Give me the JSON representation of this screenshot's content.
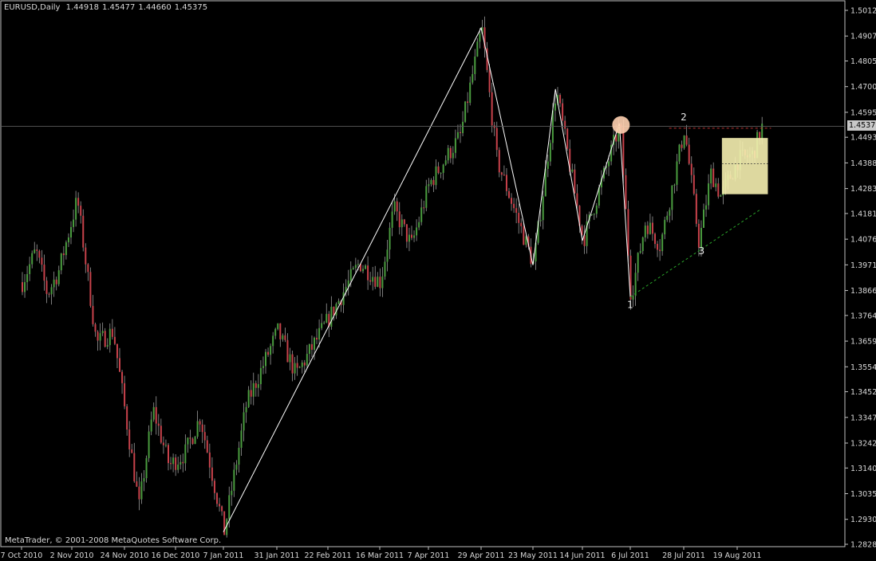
{
  "header": {
    "symbol": "EURUSD,Daily",
    "open": "1.44918",
    "high": "1.45477",
    "low": "1.44660",
    "close": "1.45375"
  },
  "footer_text": "MetaTrader, © 2001-2008 MetaQuotes Software Corp.",
  "colors": {
    "background": "#000000",
    "grid_frame": "#c0c0c0",
    "bull": "#4a9c3f",
    "bear": "#c8424b",
    "zigzag": "#ffffff",
    "trendline": "#2aa52a",
    "resistance": "#c03030",
    "highlight_box": "#f5f0b0",
    "highlight_circle": "#ffd0b0"
  },
  "chart_data": {
    "type": "candlestick",
    "title": "EURUSD,Daily",
    "ylim": [
      1.2828,
      1.5012
    ],
    "yticks": [
      "1.50120",
      "1.49070",
      "1.48050",
      "1.47000",
      "1.45950",
      "1.44930",
      "1.43880",
      "1.42830",
      "1.41810",
      "1.40760",
      "1.39710",
      "1.38660",
      "1.37640",
      "1.36590",
      "1.35540",
      "1.34520",
      "1.33470",
      "1.32420",
      "1.31400",
      "1.30350",
      "1.29300",
      "1.28280"
    ],
    "xticks": [
      "7 Oct 2010",
      "2 Nov 2010",
      "24 Nov 2010",
      "16 Dec 2010",
      "7 Jan 2011",
      "31 Jan 2011",
      "22 Feb 2011",
      "16 Mar 2011",
      "7 Apr 2011",
      "29 Apr 2011",
      "23 May 2011",
      "14 Jun 2011",
      "6 Jul 2011",
      "28 Jul 2011",
      "19 Aug 2011"
    ],
    "last_price": "1.45375",
    "zigzag_swings": [
      {
        "date": "7 Jan 2011",
        "price": 1.2878
      },
      {
        "date": "29 Apr 2011",
        "price": 1.494
      },
      {
        "date": "23 May 2011",
        "price": 1.397
      },
      {
        "date": "2 Jun 2011",
        "price": 1.469
      },
      {
        "date": "14 Jun 2011",
        "price": 1.407
      },
      {
        "date": "1 Jul 2011",
        "price": 1.455
      },
      {
        "date": "6 Jul 2011",
        "price": 1.384
      }
    ],
    "pattern_labels": [
      {
        "text": "1",
        "date": "6 Jul 2011",
        "price": 1.384
      },
      {
        "text": "2",
        "date": "28 Jul 2011",
        "price": 1.453
      },
      {
        "text": "3",
        "date": "3 Aug 2011",
        "price": 1.406
      }
    ],
    "pivots": [
      {
        "date": "7 Oct 2010",
        "price": 1.39
      },
      {
        "date": "14 Oct 2010",
        "price": 1.403
      },
      {
        "date": "20 Oct 2010",
        "price": 1.385
      },
      {
        "date": "26 Oct 2010",
        "price": 1.395
      },
      {
        "date": "4 Nov 2010",
        "price": 1.424
      },
      {
        "date": "12 Nov 2010",
        "price": 1.365
      },
      {
        "date": "19 Nov 2010",
        "price": 1.37
      },
      {
        "date": "30 Nov 2010",
        "price": 1.298
      },
      {
        "date": "6 Dec 2010",
        "price": 1.338
      },
      {
        "date": "13 Dec 2010",
        "price": 1.315
      },
      {
        "date": "20 Dec 2010",
        "price": 1.32
      },
      {
        "date": "27 Dec 2010",
        "price": 1.335
      },
      {
        "date": "7 Jan 2011",
        "price": 1.2878
      },
      {
        "date": "17 Jan 2011",
        "price": 1.34
      },
      {
        "date": "31 Jan 2011",
        "price": 1.37
      },
      {
        "date": "8 Feb 2011",
        "price": 1.352
      },
      {
        "date": "22 Feb 2011",
        "price": 1.375
      },
      {
        "date": "7 Mar 2011",
        "price": 1.398
      },
      {
        "date": "16 Mar 2011",
        "price": 1.39
      },
      {
        "date": "22 Mar 2011",
        "price": 1.42
      },
      {
        "date": "30 Mar 2011",
        "price": 1.405
      },
      {
        "date": "7 Apr 2011",
        "price": 1.43
      },
      {
        "date": "20 Apr 2011",
        "price": 1.45
      },
      {
        "date": "29 Apr 2011",
        "price": 1.494
      },
      {
        "date": "6 May 2011",
        "price": 1.44
      },
      {
        "date": "23 May 2011",
        "price": 1.397
      },
      {
        "date": "2 Jun 2011",
        "price": 1.469
      },
      {
        "date": "14 Jun 2011",
        "price": 1.407
      },
      {
        "date": "1 Jul 2011",
        "price": 1.455
      },
      {
        "date": "6 Jul 2011",
        "price": 1.384
      },
      {
        "date": "12 Jul 2011",
        "price": 1.415
      },
      {
        "date": "18 Jul 2011",
        "price": 1.405
      },
      {
        "date": "28 Jul 2011",
        "price": 1.453
      },
      {
        "date": "3 Aug 2011",
        "price": 1.406
      },
      {
        "date": "8 Aug 2011",
        "price": 1.435
      },
      {
        "date": "12 Aug 2011",
        "price": 1.425
      },
      {
        "date": "19 Aug 2011",
        "price": 1.44
      },
      {
        "date": "25 Aug 2011",
        "price": 1.442
      },
      {
        "date": "29 Aug 2011",
        "price": 1.4537
      }
    ]
  }
}
